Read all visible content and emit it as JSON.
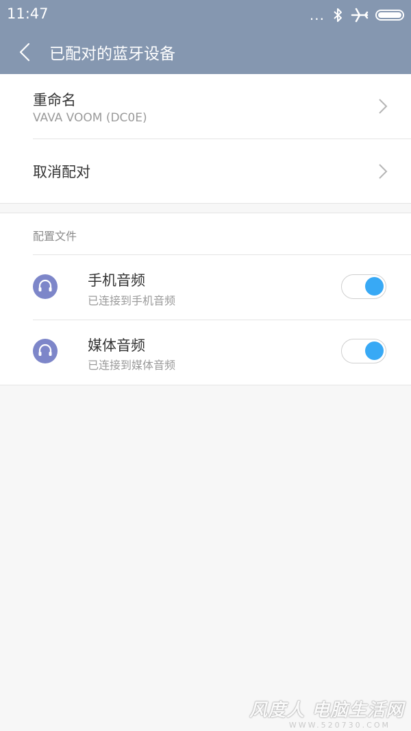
{
  "status_bar": {
    "time": "11:47",
    "icons": [
      "more-dots-icon",
      "bluetooth-icon",
      "airplane-icon",
      "battery-icon"
    ],
    "dots": "..."
  },
  "app_bar": {
    "title": "已配对的蓝牙设备",
    "back_icon": "chevron-left-icon"
  },
  "device": {
    "rename_label": "重命名",
    "device_name": "VAVA VOOM (DC0E)",
    "unpair_label": "取消配对"
  },
  "profiles": {
    "section_label": "配置文件",
    "items": [
      {
        "title": "手机音频",
        "subtitle": "已连接到手机音频",
        "icon": "headphones-icon",
        "enabled": true
      },
      {
        "title": "媒体音频",
        "subtitle": "已连接到媒体音频",
        "icon": "headphones-icon",
        "enabled": true
      }
    ]
  },
  "colors": {
    "header": "#8597b0",
    "toggle_on": "#38a9f5",
    "profile_icon": "#7d86c9"
  },
  "watermark": {
    "text": "风度人 电脑生活网",
    "sub": "WWW.520730.COM"
  }
}
